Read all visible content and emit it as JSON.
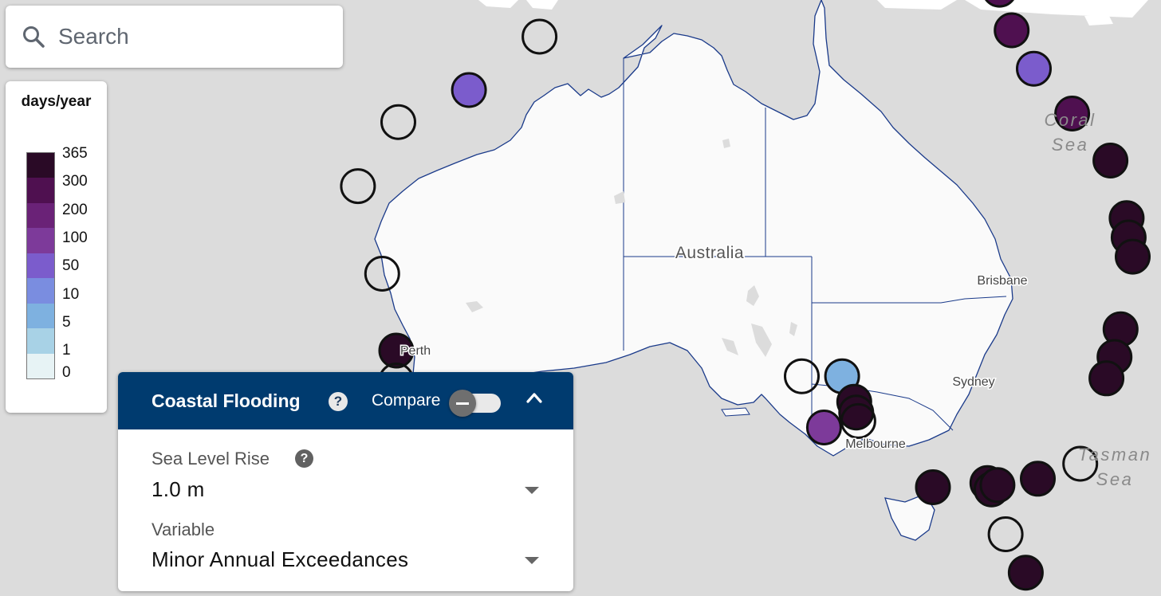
{
  "search": {
    "placeholder": "Search"
  },
  "legend": {
    "title": "days/year",
    "labels": [
      "365",
      "300",
      "200",
      "100",
      "50",
      "10",
      "5",
      "1",
      "0"
    ],
    "colors": [
      "#2a0a26",
      "#4f1050",
      "#6a2277",
      "#7d3a9a",
      "#7b5ccc",
      "#7a8de0",
      "#7eb1e0",
      "#a8d2e6",
      "#e7f3f5"
    ]
  },
  "map": {
    "country_label": "Australia",
    "cities": [
      "Brisbane",
      "Perth",
      "Sydney",
      "Melbourne"
    ],
    "seas": [
      {
        "name": "coral-sea",
        "lines": [
          "Coral",
          "Sea"
        ]
      },
      {
        "name": "tasman-sea",
        "lines": [
          "Tasman",
          "Sea"
        ]
      }
    ],
    "colors": {
      "land": "#fafafa",
      "water": "#dcdcdc",
      "border": "#1a3a8a",
      "no_data": "none"
    }
  },
  "panel": {
    "title": "Coastal Flooding",
    "help_symbol": "?",
    "compare_label": "Compare",
    "fields": [
      {
        "label": "Sea Level Rise",
        "value": "1.0 m",
        "has_help": true
      },
      {
        "label": "Variable",
        "value": "Minor Annual Exceedances",
        "has_help": false
      }
    ],
    "header_color": "#003b6f"
  },
  "stations": [
    {
      "id": "cape-york-north",
      "lon": 142.3,
      "lat": -10.6,
      "band": 8
    },
    {
      "id": "cape-york-2",
      "lon": 142.3,
      "lat": -11.9,
      "band": 5
    },
    {
      "id": "cooktown",
      "lon": 145.2,
      "lat": -15.3,
      "band": 7
    },
    {
      "id": "cairns",
      "lon": 145.8,
      "lat": -17.2,
      "band": 7
    },
    {
      "id": "townsville",
      "lon": 146.9,
      "lat": -19.0,
      "band": 4
    },
    {
      "id": "mackay",
      "lon": 148.8,
      "lat": -21.1,
      "band": 7
    },
    {
      "id": "gladstone",
      "lon": 150.7,
      "lat": -23.3,
      "band": 8
    },
    {
      "id": "brisbane-1",
      "lon": 151.5,
      "lat": -26.0,
      "band": 8
    },
    {
      "id": "brisbane-2",
      "lon": 151.6,
      "lat": -26.9,
      "band": 8
    },
    {
      "id": "brisbane-3",
      "lon": 151.8,
      "lat": -27.8,
      "band": 8
    },
    {
      "id": "port-macquarie",
      "lon": 151.2,
      "lat": -31.2,
      "band": 8
    },
    {
      "id": "sydney-1",
      "lon": 150.9,
      "lat": -32.5,
      "band": 8
    },
    {
      "id": "sydney-2",
      "lon": 150.5,
      "lat": -33.5,
      "band": 8
    },
    {
      "id": "eden",
      "lon": 149.2,
      "lat": -37.5,
      "band": null
    },
    {
      "id": "lakes-entrance",
      "lon": 147.1,
      "lat": -38.2,
      "band": 8
    },
    {
      "id": "melbourne-1",
      "lon": 144.6,
      "lat": -38.4,
      "band": 8
    },
    {
      "id": "melbourne-2",
      "lon": 144.8,
      "lat": -38.7,
      "band": 8
    },
    {
      "id": "melbourne-3",
      "lon": 145.1,
      "lat": -38.5,
      "band": 8
    },
    {
      "id": "portland",
      "lon": 141.9,
      "lat": -38.6,
      "band": 8
    },
    {
      "id": "tasmania-north",
      "lon": 145.5,
      "lat": -40.8,
      "band": null
    },
    {
      "id": "hobart",
      "lon": 146.5,
      "lat": -42.6,
      "band": 8
    },
    {
      "id": "port-lincoln",
      "lon": 135.4,
      "lat": -33.4,
      "band": null
    },
    {
      "id": "whyalla",
      "lon": 137.4,
      "lat": -33.4,
      "band": 2
    },
    {
      "id": "port-pirie",
      "lon": 138.0,
      "lat": -34.6,
      "band": 8
    },
    {
      "id": "adelaide-1",
      "lon": 138.1,
      "lat": -35.1,
      "band": 8
    },
    {
      "id": "adelaide-2",
      "lon": 138.2,
      "lat": -35.5,
      "band": null
    },
    {
      "id": "kangaroo-island",
      "lon": 136.5,
      "lat": -35.8,
      "band": 5
    },
    {
      "id": "esperance",
      "lon": 123.0,
      "lat": -35.3,
      "band": null
    },
    {
      "id": "perth",
      "lon": 115.3,
      "lat": -32.2,
      "band": 8
    },
    {
      "id": "perth-south",
      "lon": 115.3,
      "lat": -33.6,
      "band": null
    },
    {
      "id": "geraldton",
      "lon": 114.6,
      "lat": -28.6,
      "band": null
    },
    {
      "id": "carnarvon",
      "lon": 113.4,
      "lat": -24.5,
      "band": null
    },
    {
      "id": "onslow",
      "lon": 115.4,
      "lat": -21.5,
      "band": null
    },
    {
      "id": "port-hedland",
      "lon": 118.9,
      "lat": -20.0,
      "band": 4
    },
    {
      "id": "broome",
      "lon": 122.4,
      "lat": -17.5,
      "band": null
    },
    {
      "id": "derby",
      "lon": 126.4,
      "lat": -14.7,
      "band": null
    },
    {
      "id": "darwin",
      "lon": 129.6,
      "lat": -12.3,
      "band": 5
    }
  ]
}
